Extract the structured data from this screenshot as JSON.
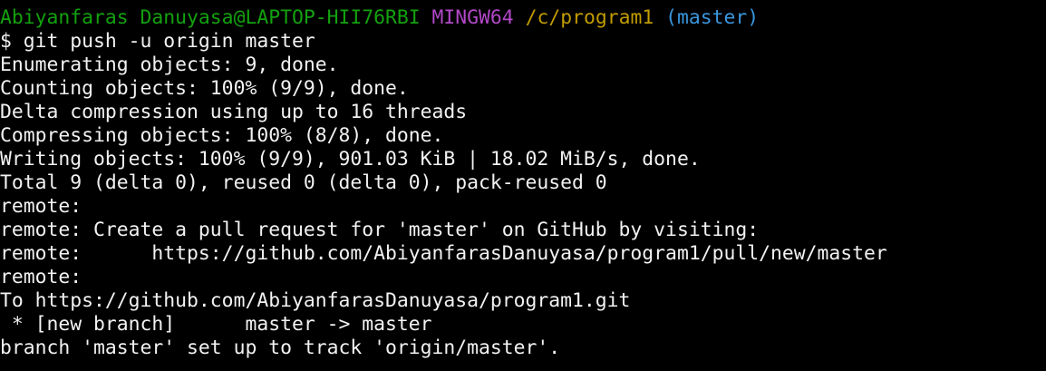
{
  "prompt": {
    "user_host": "Abiyanfaras Danuyasa@LAPTOP-HII76RBI",
    "system": "MINGW64",
    "path": "/c/program1",
    "branch": "(master)"
  },
  "command": "$ git push -u origin master",
  "output": [
    "Enumerating objects: 9, done.",
    "Counting objects: 100% (9/9), done.",
    "Delta compression using up to 16 threads",
    "Compressing objects: 100% (8/8), done.",
    "Writing objects: 100% (9/9), 901.03 KiB | 18.02 MiB/s, done.",
    "Total 9 (delta 0), reused 0 (delta 0), pack-reused 0",
    "remote:",
    "remote: Create a pull request for 'master' on GitHub by visiting:",
    "remote:      https://github.com/AbiyanfarasDanuyasa/program1/pull/new/master",
    "remote:",
    "To https://github.com/AbiyanfarasDanuyasa/program1.git",
    " * [new branch]      master -> master",
    "branch 'master' set up to track 'origin/master'."
  ],
  "colors": {
    "background": "#000000",
    "text": "#f2f2f2",
    "user_host": "#13a10e",
    "system": "#b148c6",
    "path": "#c19c00",
    "branch": "#3a96dd"
  }
}
